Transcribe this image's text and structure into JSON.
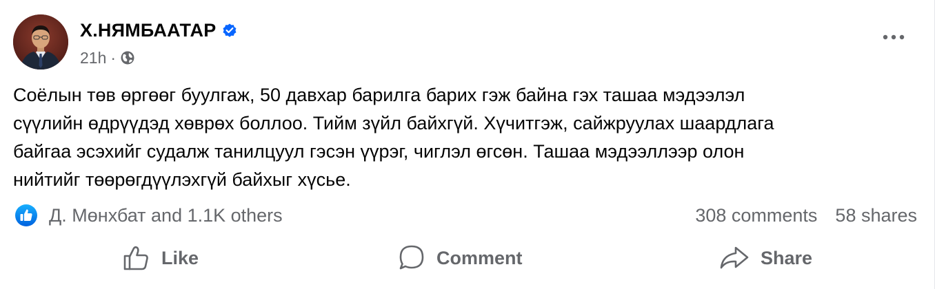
{
  "post": {
    "author": "Х.НЯМБААТАР",
    "timestamp": "21h",
    "meta_separator": "·",
    "visibility_icon": "globe-icon",
    "verified_icon": "verified-badge-icon",
    "more_icon": "more-horizontal-icon",
    "text_lines": [
      "Соёлын төв өргөөг буулгаж, 50 давхар барилга барих гэж байна гэх ташаа мэдээлэл",
      "сүүлийн өдрүүдэд хөврөх боллоо. Тийм зүйл байхгүй. Хүчитгэж, сайжруулах шаардлага",
      "байгаа эсэхийг судалж танилцуул гэсэн үүрэг, чиглэл өгсөн. Ташаа мэдээллээр олон",
      "нийтийг төөрөгдүүлэхгүй байхыг хүсье."
    ]
  },
  "engagement": {
    "reaction_icon": "like-reaction-icon",
    "reactions_text": "Д. Мөнхбат and 1.1K others",
    "comments": "308 comments",
    "shares": "58 shares"
  },
  "actions": {
    "like_label": "Like",
    "comment_label": "Comment",
    "share_label": "Share"
  },
  "colors": {
    "text": "#050505",
    "secondary": "#65676b",
    "accent": "#0866ff"
  }
}
